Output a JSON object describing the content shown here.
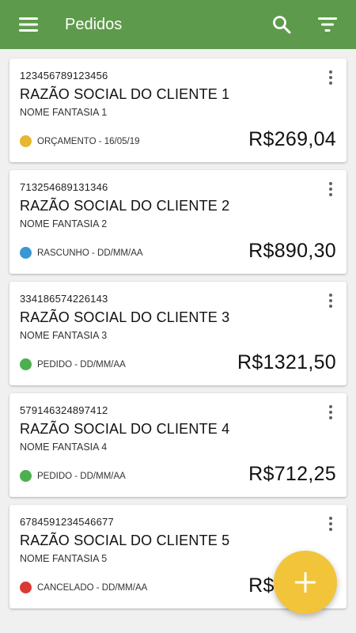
{
  "app_bar": {
    "title": "Pedidos",
    "background": "#5e9a4b",
    "icons": [
      "menu-icon",
      "search-icon",
      "filter-icon"
    ]
  },
  "orders": [
    {
      "code": "123456789123456",
      "razao_social": "RAZÃO SOCIAL DO CLIENTE 1",
      "nome_fantasia": "NOME FANTASIA 1",
      "status": "ORÇAMENTO - 16/05/19",
      "status_color": "#e8b62f",
      "valor": "R$269,04"
    },
    {
      "code": "713254689131346",
      "razao_social": "RAZÃO SOCIAL DO CLIENTE 2",
      "nome_fantasia": "NOME FANTASIA 2",
      "status": "RASCUNHO - DD/MM/AA",
      "status_color": "#3a97d4",
      "valor": "R$890,30"
    },
    {
      "code": "334186574226143",
      "razao_social": "RAZÃO SOCIAL DO CLIENTE 3",
      "nome_fantasia": "NOME FANTASIA 3",
      "status": "PEDIDO - DD/MM/AA",
      "status_color": "#4caf50",
      "valor": "R$1321,50"
    },
    {
      "code": "579146324897412",
      "razao_social": "RAZÃO SOCIAL DO CLIENTE 4",
      "nome_fantasia": "NOME FANTASIA 4",
      "status": "PEDIDO - DD/MM/AA",
      "status_color": "#4caf50",
      "valor": "R$712,25"
    },
    {
      "code": "6784591234546677",
      "razao_social": "RAZÃO SOCIAL DO CLIENTE 5",
      "nome_fantasia": "NOME FANTASIA 5",
      "status": "CANCELADO - DD/MM/AA",
      "status_color": "#d93a33",
      "valor": "R$546,10"
    }
  ],
  "fab": {
    "icon": "plus-icon",
    "color": "#f2c43a"
  }
}
